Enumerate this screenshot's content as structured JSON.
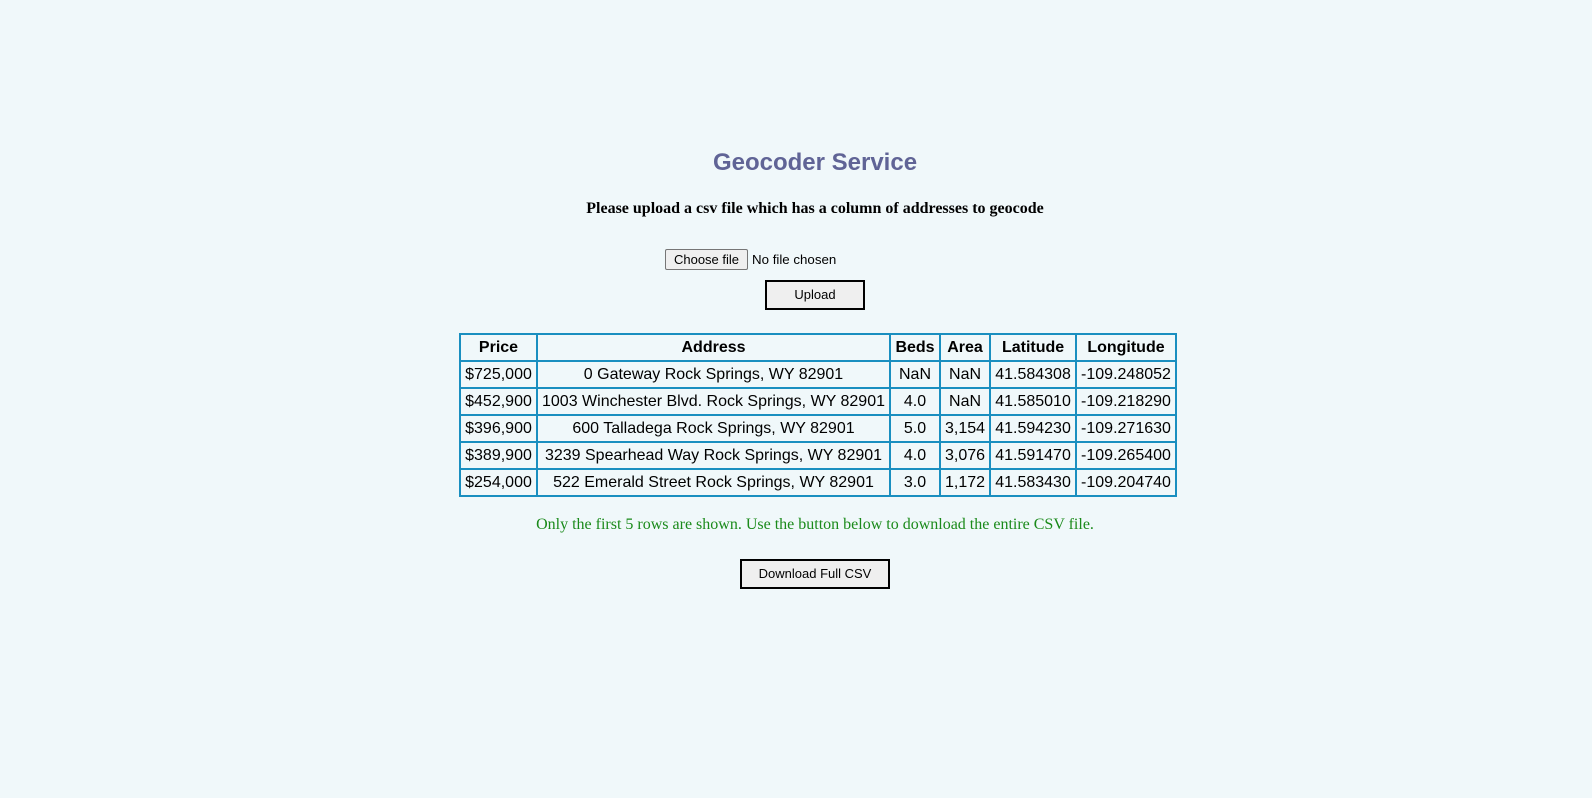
{
  "page": {
    "title": "Geocoder Service",
    "instructions": "Please upload a csv file which has a column of addresses to geocode"
  },
  "upload_form": {
    "choose_file_label": "Choose file",
    "file_status": "No file chosen",
    "upload_label": "Upload"
  },
  "table": {
    "headers": [
      "Price",
      "Address",
      "Beds",
      "Area",
      "Latitude",
      "Longitude"
    ],
    "rows": [
      [
        "$725,000",
        "0 Gateway Rock Springs, WY 82901",
        "NaN",
        "NaN",
        "41.584308",
        "-109.248052"
      ],
      [
        "$452,900",
        "1003 Winchester Blvd. Rock Springs, WY 82901",
        "4.0",
        "NaN",
        "41.585010",
        "-109.218290"
      ],
      [
        "$396,900",
        "600 Talladega Rock Springs, WY 82901",
        "5.0",
        "3,154",
        "41.594230",
        "-109.271630"
      ],
      [
        "$389,900",
        "3239 Spearhead Way Rock Springs, WY 82901",
        "4.0",
        "3,076",
        "41.591470",
        "-109.265400"
      ],
      [
        "$254,000",
        "522 Emerald Street Rock Springs, WY 82901",
        "3.0",
        "1,172",
        "41.583430",
        "-109.204740"
      ]
    ]
  },
  "note": "Only the first 5 rows are shown. Use the button below to download the entire CSV file.",
  "download_label": "Download Full CSV",
  "colors": {
    "background": "#f0f8fa",
    "title": "#606496",
    "table_border": "#1a8fc0",
    "note": "#1a8a1a"
  }
}
